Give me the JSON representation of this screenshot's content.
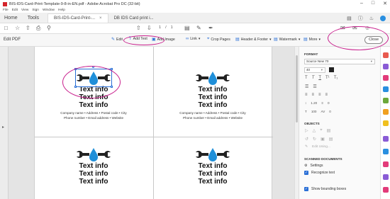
{
  "window": {
    "title": "BIS-IDS-Card-Print-Template-9-8-in-EN.pdf - Adobe Acrobat Pro DC (32-bit)",
    "controls": [
      "–",
      "□",
      "✕"
    ]
  },
  "menu": [
    "File",
    "Edit",
    "View",
    "Sign",
    "Window",
    "Help"
  ],
  "tabs": {
    "home": "Home",
    "tools": "Tools",
    "doc1": "BIS-IDS-Card-Print-...",
    "doc2": "DB IDS Card print i...",
    "close": "×"
  },
  "toolbar": {
    "page_current": "1",
    "page_sep": "/",
    "page_total": "1"
  },
  "editbar": {
    "title": "Edit PDF",
    "edit": "Edit",
    "add_text": "Add Text",
    "add_image": "Add Image",
    "link": "Link",
    "crop_pages": "Crop Pages",
    "header_footer": "Header & Footer",
    "watermark": "Watermark",
    "more": "More",
    "close": "Close"
  },
  "cards": [
    {
      "lines": [
        "Text info",
        "Text info",
        "Text info"
      ],
      "company": "Company name • Address • Postal code • City",
      "contact": "Phone number • Email address • Website"
    },
    {
      "lines": [
        "Text info",
        "Text info",
        "Text info"
      ],
      "company": "Company name • Address • Postal code • City",
      "contact": "Phone number • Email address • Website"
    },
    {
      "lines": [
        "Text info",
        "Text info",
        "Text info"
      ]
    },
    {
      "lines": [
        "Text info",
        "Text info",
        "Text info"
      ]
    }
  ],
  "panel": {
    "format_heading": "FORMAT",
    "font_name": "Source New 70",
    "font_size": "40",
    "line_spacing": "1.20",
    "para_spacing": "0",
    "scale": "100",
    "char_spacing": "0",
    "objects_heading": "OBJECTS",
    "edit_using": "Edit Using...",
    "scanned_heading": "SCANNED DOCUMENTS",
    "settings": "Settings",
    "recognize": "Recognize text",
    "bounding": "Show bounding boxes"
  },
  "colors": {
    "accent": "#2a6fd6",
    "annotation": "#c81e8c",
    "logo_dark": "#222222",
    "logo_drop": "#1f8fd9"
  }
}
